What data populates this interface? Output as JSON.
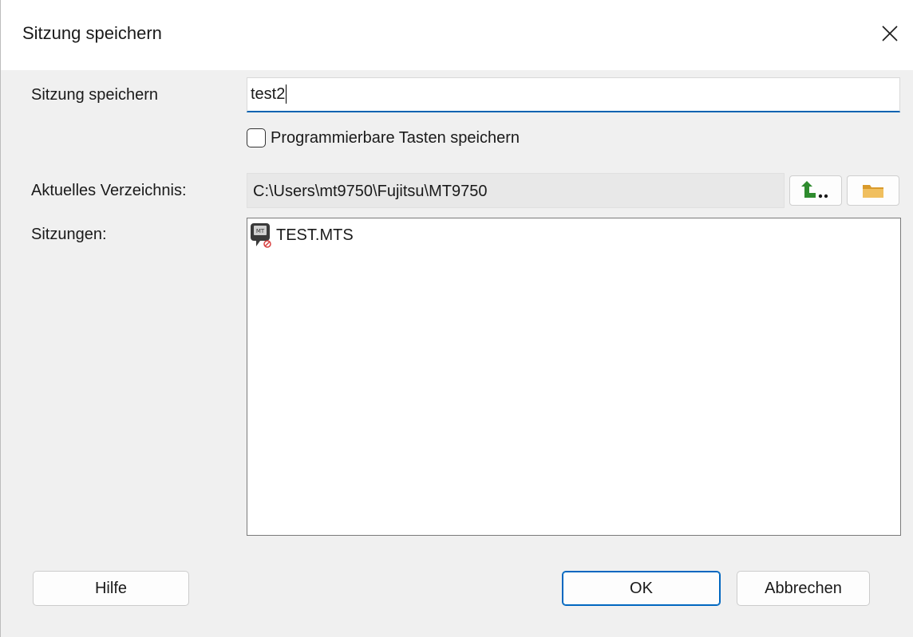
{
  "window": {
    "title": "Sitzung speichern"
  },
  "form": {
    "name_label": "Sitzung speichern",
    "name_value": "test2",
    "save_keys_label": "Programmierbare Tasten speichern",
    "save_keys_checked": false,
    "current_dir_label": "Aktuelles Verzeichnis:",
    "current_dir_value": "C:\\Users\\mt9750\\Fujitsu\\MT9750",
    "sessions_label": "Sitzungen:"
  },
  "sessions": [
    {
      "name": "TEST.MTS",
      "icon": "mt-session-file-icon"
    }
  ],
  "toolbar": {
    "up_icon": "up-directory-icon",
    "browse_icon": "folder-icon"
  },
  "buttons": {
    "help": "Hilfe",
    "ok": "OK",
    "cancel": "Abbrechen"
  },
  "colors": {
    "accent": "#0067c0",
    "up_arrow": "#2e8b2e",
    "folder": "#e8b04a"
  }
}
